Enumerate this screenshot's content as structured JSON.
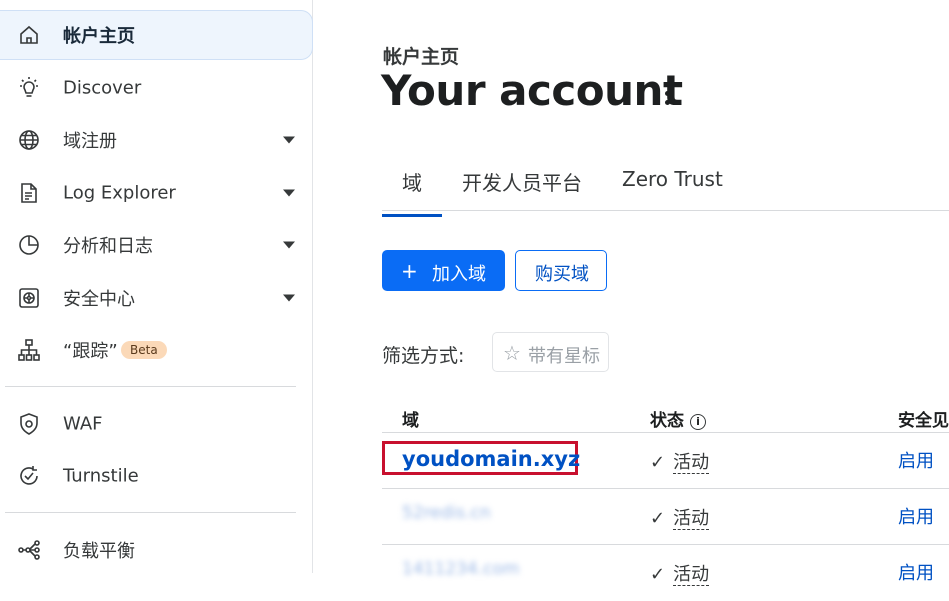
{
  "sidebar": {
    "items": [
      {
        "label": "帐户主页",
        "icon": "home-icon"
      },
      {
        "label": "Discover",
        "icon": "lightbulb-icon"
      },
      {
        "label": "域注册",
        "icon": "globe-icon"
      },
      {
        "label": "Log Explorer",
        "icon": "log-document-icon"
      },
      {
        "label": "分析和日志",
        "icon": "pie-chart-icon"
      },
      {
        "label": "安全中心",
        "icon": "security-center-icon"
      },
      {
        "label": "“跟踪”",
        "icon": "trace-tree-icon",
        "badge": "Beta"
      },
      {
        "label": "WAF",
        "icon": "shield-gear-icon"
      },
      {
        "label": "Turnstile",
        "icon": "turnstile-check-icon"
      },
      {
        "label": "负载平衡",
        "icon": "load-balancer-icon"
      }
    ]
  },
  "header": {
    "breadcrumb": "帐户主页",
    "title": "Your account"
  },
  "tabs": [
    "域",
    "开发人员平台",
    "Zero Trust"
  ],
  "actions": {
    "add_plus": "+",
    "add_label": "加入域",
    "buy_label": "购买域"
  },
  "filter": {
    "label": "筛选方式:",
    "star_icon": "☆",
    "starred_label": "带有星标"
  },
  "table": {
    "columns": [
      "域",
      "状态",
      "安全见解"
    ],
    "rows": [
      {
        "domain": "youdomain.xyz",
        "status": "活动",
        "security": "启用"
      },
      {
        "domain": "52redis.cn",
        "status": "活动",
        "security": "启用"
      },
      {
        "domain": "1411234.com",
        "status": "活动",
        "security": "启用"
      }
    ]
  },
  "colors": {
    "accent": "#0a6cf5",
    "link": "#0051c3",
    "highlight_border": "#c8102e",
    "active_nav_bg": "#eef5fd",
    "beta_badge_bg": "#fbd9b8"
  }
}
